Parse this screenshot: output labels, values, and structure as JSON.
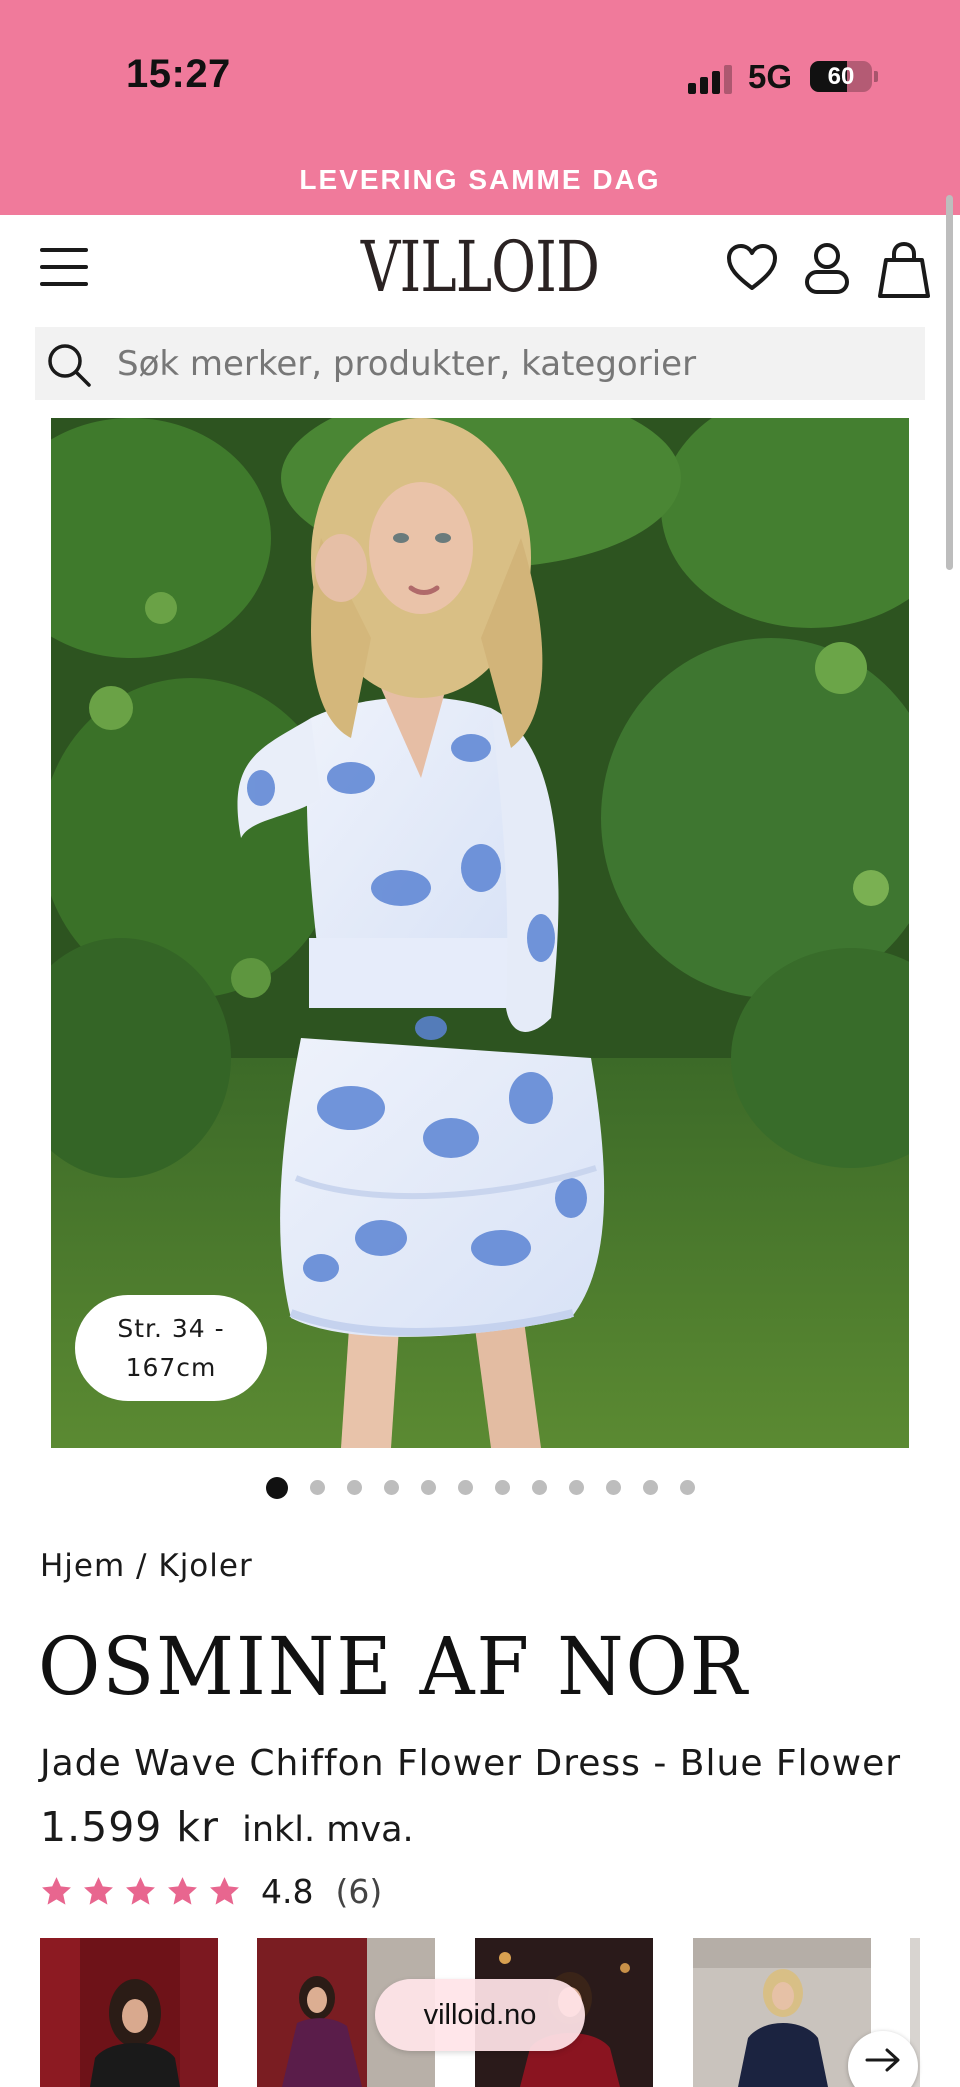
{
  "status_bar": {
    "time": "15:27",
    "network": "5G",
    "battery": "60",
    "battery_level": 0.6
  },
  "promo_banner": "LEVERING SAMME DAG",
  "header": {
    "logo": "VILLOID",
    "icons": [
      "menu-icon",
      "heart-icon",
      "user-icon",
      "bag-icon"
    ]
  },
  "search": {
    "placeholder": "Søk merker, produkter, kategorier",
    "icon": "search-icon"
  },
  "gallery": {
    "size_badge": "Str. 34 - 167cm",
    "image_count": 12,
    "active_index": 0
  },
  "breadcrumb": {
    "home": "Hjem",
    "separator": " / ",
    "category": "Kjoler"
  },
  "product": {
    "brand": "OSMINE AF NOR",
    "name": "Jade Wave Chiffon Flower Dress - Blue Flower",
    "price": "1.599 kr",
    "vat_note": "inkl. mva.",
    "rating": "4.8",
    "rating_stars": 5,
    "review_count": "(6)"
  },
  "related": {
    "count": 4,
    "url_pill": "villoid.no",
    "next_icon": "arrow-right-icon"
  },
  "colors": {
    "brand_pink": "#f07a9b",
    "star_pink": "#e8668f",
    "text": "#1a1a1a"
  }
}
